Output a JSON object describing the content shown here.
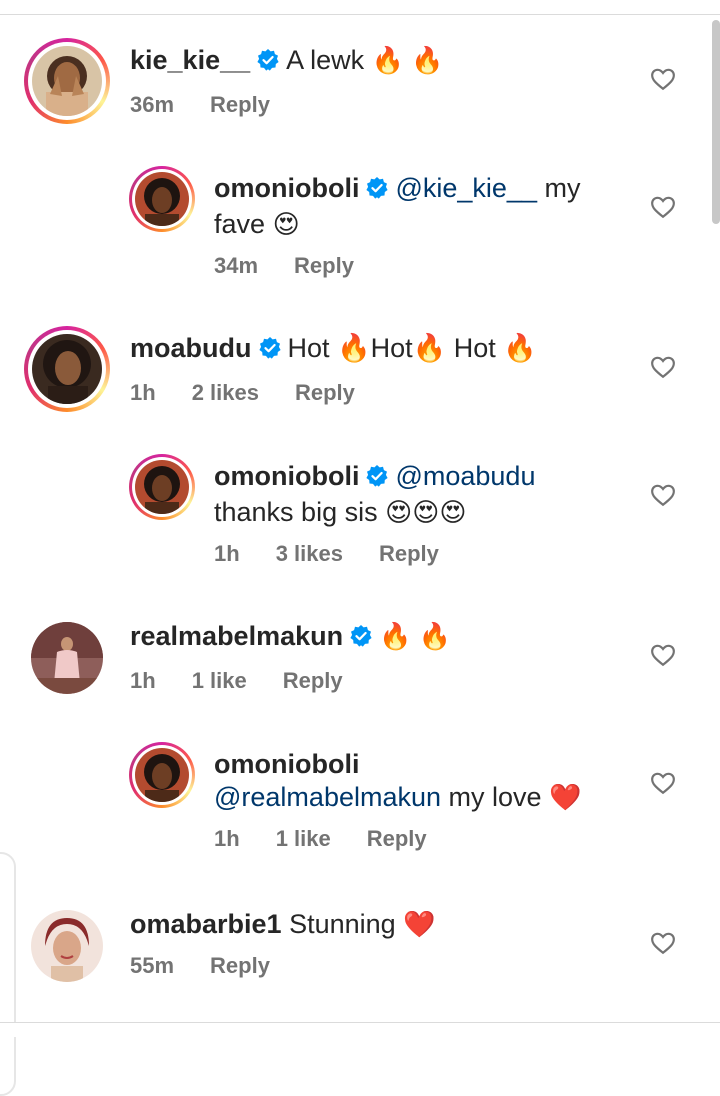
{
  "comments": [
    {
      "username": "kie_kie__",
      "text": "A lewk",
      "emoji": "🔥 🔥",
      "time": "36m",
      "likes": "",
      "reply_label": "Reply"
    },
    {
      "username": "omonioboli",
      "mention": "@kie_kie__",
      "text_line1": "my",
      "text_line2": "fave",
      "emoji": "😍",
      "time": "34m",
      "likes": "",
      "reply_label": "Reply"
    },
    {
      "username": "moabudu",
      "text": "Hot 🔥Hot🔥 Hot 🔥",
      "time": "1h",
      "likes": "2 likes",
      "reply_label": "Reply"
    },
    {
      "username": "omonioboli",
      "mention": "@moabudu",
      "text_line2": "thanks big sis",
      "emoji": "😍😍😍",
      "time": "1h",
      "likes": "3 likes",
      "reply_label": "Reply"
    },
    {
      "username": "realmabelmakun",
      "emoji": "🔥 🔥",
      "time": "1h",
      "likes": "1 like",
      "reply_label": "Reply"
    },
    {
      "username": "omonioboli",
      "mention": "@realmabelmakun",
      "text_line2": "my love",
      "emoji": "❤️",
      "time": "1h",
      "likes": "1 like",
      "reply_label": "Reply"
    },
    {
      "username": "omabarbie1",
      "text": "Stunning",
      "emoji": "❤️",
      "time": "55m",
      "likes": "",
      "reply_label": "Reply"
    }
  ],
  "colors": {
    "verified": "#0095f6",
    "mention": "#00376b",
    "meta": "#737373"
  }
}
